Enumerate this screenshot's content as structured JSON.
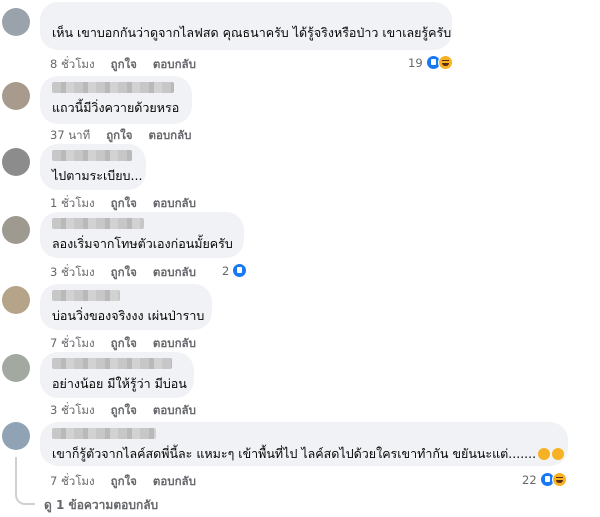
{
  "comments": [
    {
      "text": "เห็น เขาบอกกันว่าดูจากไลฟสด คุณธนาครับ  ได้รู้จริงหรือป่าว เขาเลยรู้ครับ",
      "time": "8 ชั่วโมง",
      "like": "ถูกใจ",
      "reply": "ตอบกลับ",
      "reactions": {
        "count": "19",
        "icons": [
          "like-icon",
          "haha-icon"
        ]
      }
    },
    {
      "text": "แถวนี้มีวิ่งควายด้วยหรอ",
      "time": "37 นาที",
      "like": "ถูกใจ",
      "reply": "ตอบกลับ"
    },
    {
      "text": "ไปตามระเบียบ...",
      "time": "1 ชั่วโมง",
      "like": "ถูกใจ",
      "reply": "ตอบกลับ"
    },
    {
      "text": "ลองเริ่มจากโทษตัวเองก่อนมั้ยครับ",
      "time": "3 ชั่วโมง",
      "like": "ถูกใจ",
      "reply": "ตอบกลับ",
      "reactions": {
        "count": "2",
        "icons": [
          "like-icon"
        ]
      }
    },
    {
      "text": "บ่อนวิ่งของจริงงง เผ่นป่าราบ",
      "time": "7 ชั่วโมง",
      "like": "ถูกใจ",
      "reply": "ตอบกลับ"
    },
    {
      "text": "อย่างน้อย มีให้รู้ว่า มีบ่อน",
      "time": "3 ชั่วโมง",
      "like": "ถูกใจ",
      "reply": "ตอบกลับ"
    },
    {
      "text": "เขาก็รู้ตัวจากไลค์สดพี่นี้ละ แหมะๆ เข้าพื้นที่ไป ไลค์สดไปด้วยใครเขาทำกัน ขยันนะแต่.......",
      "time": "7 ชั่วโมง",
      "like": "ถูกใจ",
      "reply": "ตอบกลับ",
      "reactions": {
        "count": "22",
        "icons": [
          "like-icon",
          "haha-icon"
        ]
      }
    }
  ],
  "view_replies": "ดู 1 ข้อความตอบกลับ"
}
